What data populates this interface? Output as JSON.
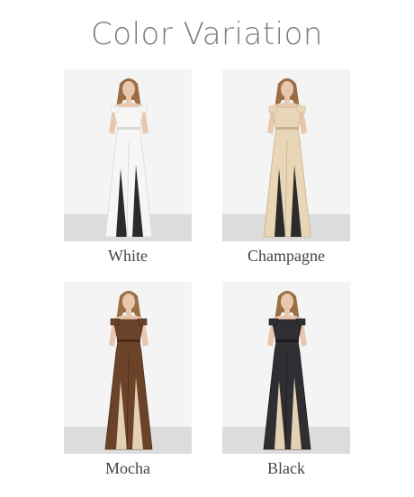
{
  "title": "Color Variation",
  "variants": [
    {
      "label": "White",
      "dress": "#f6f6f4",
      "shade": "#d9d9d6",
      "insert": "#2b2b2b"
    },
    {
      "label": "Champagne",
      "dress": "#e8d6b6",
      "shade": "#c9b38d",
      "insert": "#2b2b2b"
    },
    {
      "label": "Mocha",
      "dress": "#6b4328",
      "shade": "#4a2c19",
      "insert": "#e6d0b2"
    },
    {
      "label": "Black",
      "dress": "#2f2f33",
      "shade": "#1a1a1d",
      "insert": "#e6d0b2"
    }
  ]
}
